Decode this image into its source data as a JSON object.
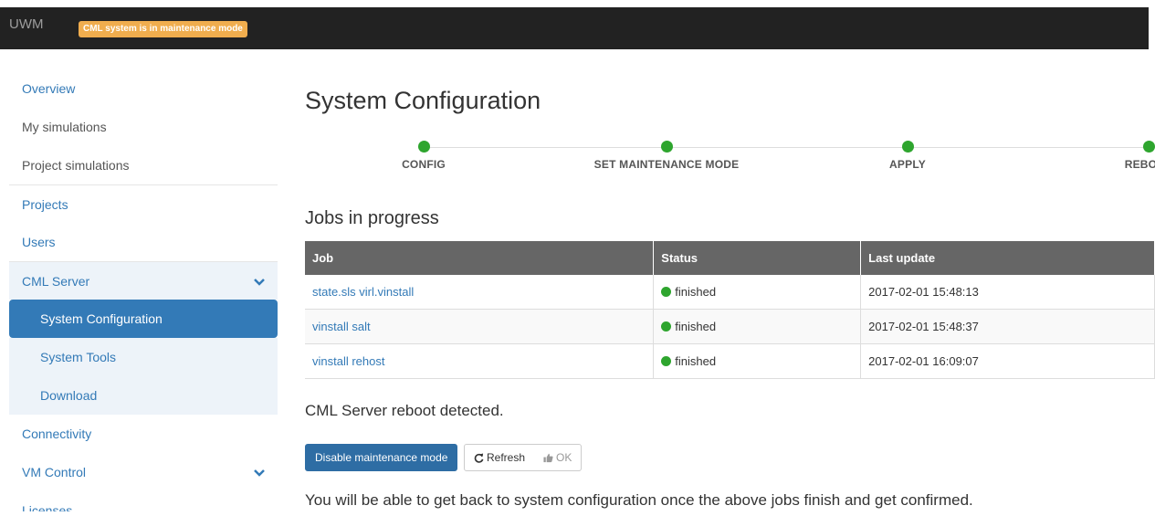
{
  "topbar": {
    "brand": "UWM",
    "badge": "CML system is in maintenance mode"
  },
  "sidebar": {
    "items": [
      {
        "label": "Overview"
      },
      {
        "label": "My simulations"
      },
      {
        "label": "Project simulations"
      },
      {
        "label": "Projects"
      },
      {
        "label": "Users"
      },
      {
        "label": "CML Server"
      },
      {
        "label": "System Configuration"
      },
      {
        "label": "System Tools"
      },
      {
        "label": "Download"
      },
      {
        "label": "Connectivity"
      },
      {
        "label": "VM Control"
      },
      {
        "label": "Licenses"
      }
    ]
  },
  "main": {
    "title": "System Configuration",
    "steps": [
      "CONFIG",
      "SET MAINTENANCE MODE",
      "APPLY",
      "REBOOT"
    ],
    "jobs_title": "Jobs in progress",
    "table": {
      "headers": [
        "Job",
        "Status",
        "Last update"
      ],
      "rows": [
        {
          "job": "state.sls virl.vinstall",
          "status": "finished",
          "updated": "2017-02-01 15:48:13"
        },
        {
          "job": "vinstall salt",
          "status": "finished",
          "updated": "2017-02-01 15:48:37"
        },
        {
          "job": "vinstall rehost",
          "status": "finished",
          "updated": "2017-02-01 16:09:07"
        }
      ]
    },
    "reboot_text": "CML Server reboot detected.",
    "buttons": {
      "disable": "Disable maintenance mode",
      "refresh": "Refresh",
      "ok": "OK"
    },
    "note": "You will be able to get back to system configuration once the above jobs finish and get confirmed."
  },
  "colors": {
    "accent": "#337ab7",
    "badge": "#f0ad4e",
    "success": "#2ea52e",
    "topbar": "#222222"
  }
}
